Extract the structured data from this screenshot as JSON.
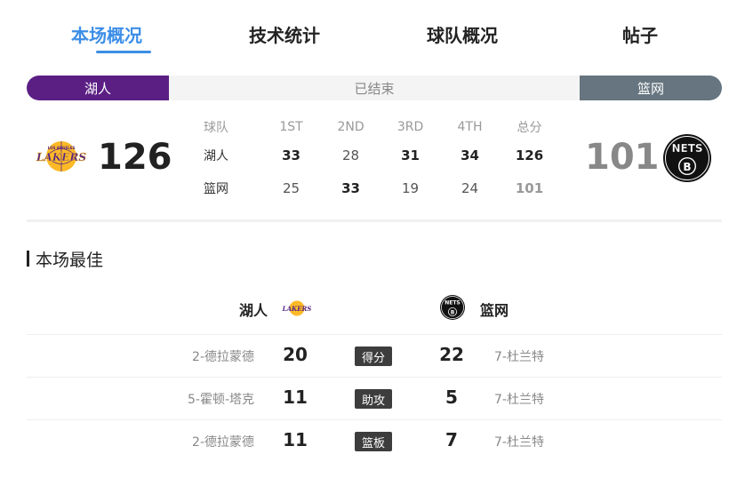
{
  "tabs": [
    {
      "label": "本场概况",
      "active": true
    },
    {
      "label": "技术统计",
      "active": false
    },
    {
      "label": "球队概况",
      "active": false
    },
    {
      "label": "帖子",
      "active": false
    }
  ],
  "status": {
    "home_team": "湖人",
    "state": "已结束",
    "away_team": "篮网"
  },
  "colors": {
    "accent": "#3d8ee6",
    "home_color": "#5b1f84",
    "away_color": "#66757f"
  },
  "score": {
    "home": "126",
    "away": "101"
  },
  "quarters": {
    "headers": [
      "球队",
      "1ST",
      "2ND",
      "3RD",
      "4TH",
      "总分"
    ],
    "rows": [
      {
        "team": "湖人",
        "q": [
          "33",
          "28",
          "31",
          "34"
        ],
        "total": "126"
      },
      {
        "team": "篮网",
        "q": [
          "25",
          "33",
          "19",
          "24"
        ],
        "total": "101"
      }
    ]
  },
  "best": {
    "title": "本场最佳",
    "home_team": "湖人",
    "away_team": "篮网",
    "rows": [
      {
        "home_player": "2-德拉蒙德",
        "home_value": "20",
        "stat": "得分",
        "away_value": "22",
        "away_player": "7-杜兰特"
      },
      {
        "home_player": "5-霍顿-塔克",
        "home_value": "11",
        "stat": "助攻",
        "away_value": "5",
        "away_player": "7-杜兰特"
      },
      {
        "home_player": "2-德拉蒙德",
        "home_value": "11",
        "stat": "篮板",
        "away_value": "7",
        "away_player": "7-杜兰特"
      }
    ]
  },
  "logos": {
    "home_icon": "lakers-logo-icon",
    "home_text": "LAKERS",
    "home_subtext": "LOS ANGELES",
    "away_icon": "nets-logo-icon",
    "away_text": "NETS"
  }
}
